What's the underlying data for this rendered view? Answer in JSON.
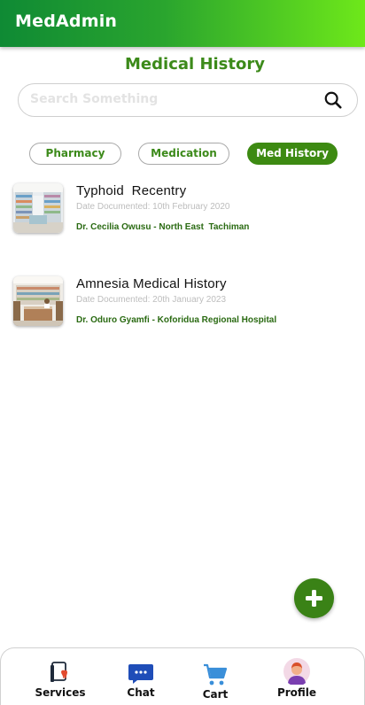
{
  "app": {
    "title": "MedAdmin"
  },
  "page": {
    "title": "Medical History"
  },
  "search": {
    "placeholder": "Search Something",
    "value": ""
  },
  "tabs": [
    {
      "label": "Pharmacy",
      "active": false
    },
    {
      "label": "Medication",
      "active": false
    },
    {
      "label": "Med History",
      "active": true
    }
  ],
  "records": [
    {
      "title": "Typhoid  Recentry",
      "date": "Date Documented: 10th February 2020",
      "doctor": "Dr. Cecilia Owusu - North East  Tachiman",
      "image": "pharmacy-shelves-thumbnail"
    },
    {
      "title": "Amnesia Medical History",
      "date": "Date Documented: 20th January 2023",
      "doctor": "Dr. Oduro Gyamfi - Koforidua Regional Hospital",
      "image": "pharmacy-counter-thumbnail"
    }
  ],
  "fab": {
    "icon": "plus-icon"
  },
  "bottom_nav": [
    {
      "label": "Services",
      "icon": "tooth-document-icon"
    },
    {
      "label": "Chat",
      "icon": "chat-bubble-icon"
    },
    {
      "label": "Cart",
      "icon": "shopping-cart-icon"
    },
    {
      "label": "Profile",
      "icon": "avatar-icon"
    }
  ],
  "colors": {
    "brand_green": "#3c8a1a",
    "app_bar_start": "#0f8a34",
    "app_bar_end": "#6ee81a",
    "chip_active": "#3d8a12"
  }
}
